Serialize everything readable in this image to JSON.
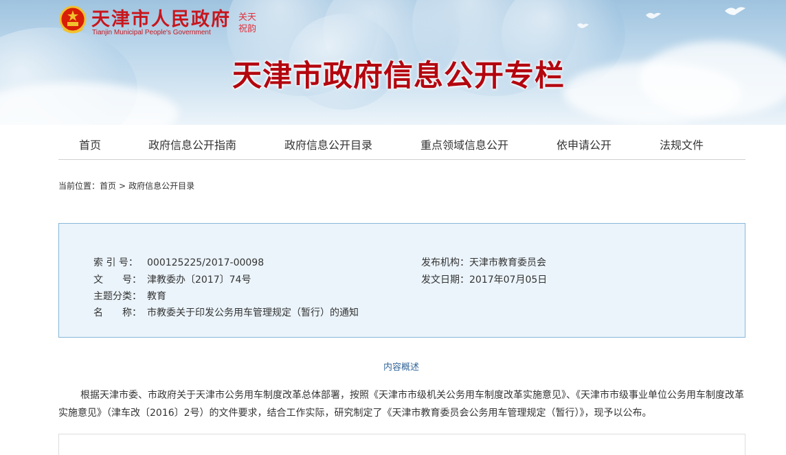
{
  "header": {
    "logo_cn": "天津市人民政府",
    "logo_en": "Tianjin Municipal People's Government",
    "seal_text": "关天祝韵",
    "title": "天津市政府信息公开专栏"
  },
  "nav": {
    "items": [
      {
        "label": "首页"
      },
      {
        "label": "政府信息公开指南"
      },
      {
        "label": "政府信息公开目录"
      },
      {
        "label": "重点领域信息公开"
      },
      {
        "label": "依申请公开"
      },
      {
        "label": "法规文件"
      }
    ]
  },
  "breadcrumb": {
    "prefix": "当前位置：",
    "home": "首页",
    "separator": ">",
    "current": "政府信息公开目录"
  },
  "info": {
    "index_label": "索 引 号：",
    "index_value": "000125225/2017-00098",
    "docno_label_a": "文",
    "docno_label_b": "号：",
    "docno_value": "津教委办〔2017〕74号",
    "topic_label": "主题分类：",
    "topic_value": "教育",
    "name_label_a": "名",
    "name_label_b": "称：",
    "name_value": "市教委关于印发公务用车管理规定（暂行）的通知",
    "publisher_label": "发布机构：",
    "publisher_value": "天津市教育委员会",
    "date_label": "发文日期：",
    "date_value": "2017年07月05日"
  },
  "summary": {
    "heading": "内容概述",
    "text": "根据天津市委、市政府关于天津市公务用车制度改革总体部署，按照《天津市市级机关公务用车制度改革实施意见》、《天津市市级事业单位公务用车制度改革实施意见》（津车改〔2016〕2号）的文件要求，结合工作实际，研究制定了《天津市教育委员会公务用车管理规定（暂行）》，现予以公布。"
  },
  "colors": {
    "brand_red": "#c8161d",
    "title_red": "#b3060f",
    "info_bg": "#ebf4fb",
    "info_border": "#87b6d8",
    "link_blue": "#336699"
  }
}
